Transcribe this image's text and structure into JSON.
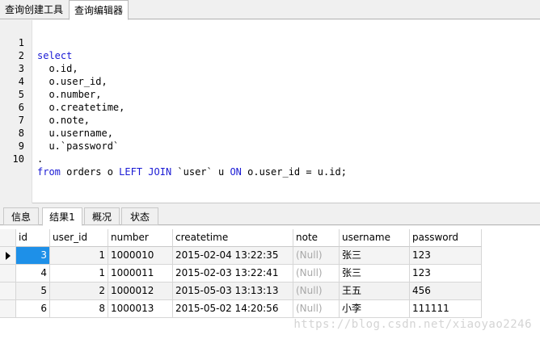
{
  "top_tabs": [
    "查询创建工具",
    "查询编辑器"
  ],
  "editor": {
    "lines": [
      {
        "num": "1",
        "kw": "select",
        "text": ""
      },
      {
        "num": "2",
        "kw": "",
        "text": "  o.id,"
      },
      {
        "num": "3",
        "kw": "",
        "text": "  o.user_id,"
      },
      {
        "num": "4",
        "kw": "",
        "text": "  o.number,"
      },
      {
        "num": "5",
        "kw": "",
        "text": "  o.createtime,"
      },
      {
        "num": "6",
        "kw": "",
        "text": "  o.note,"
      },
      {
        "num": "7",
        "kw": "",
        "text": "  u.username,"
      },
      {
        "num": "8",
        "kw": "",
        "text": "  u.`password`"
      },
      {
        "num": "9",
        "kw": "",
        "text": "."
      },
      {
        "num": "10",
        "kw": "from",
        "text": " orders o ",
        "kw2": "LEFT JOIN",
        "text2": " `user` u ",
        "kw3": "ON",
        "text3": " o.user_id = u.id;"
      }
    ]
  },
  "result_tabs": [
    "信息",
    "结果1",
    "概况",
    "状态"
  ],
  "grid": {
    "columns": [
      "id",
      "user_id",
      "number",
      "createtime",
      "note",
      "username",
      "password"
    ],
    "rows": [
      [
        "3",
        "1",
        "1000010",
        "2015-02-04 13:22:35",
        "(Null)",
        "张三",
        "123"
      ],
      [
        "4",
        "1",
        "1000011",
        "2015-02-03 13:22:41",
        "(Null)",
        "张三",
        "123"
      ],
      [
        "5",
        "2",
        "1000012",
        "2015-05-03 13:13:13",
        "(Null)",
        "王五",
        "456"
      ],
      [
        "6",
        "8",
        "1000013",
        "2015-05-02 14:20:56",
        "(Null)",
        "小李",
        "111111"
      ]
    ]
  },
  "watermark": "https://blog.csdn.net/xiaoyao2246"
}
